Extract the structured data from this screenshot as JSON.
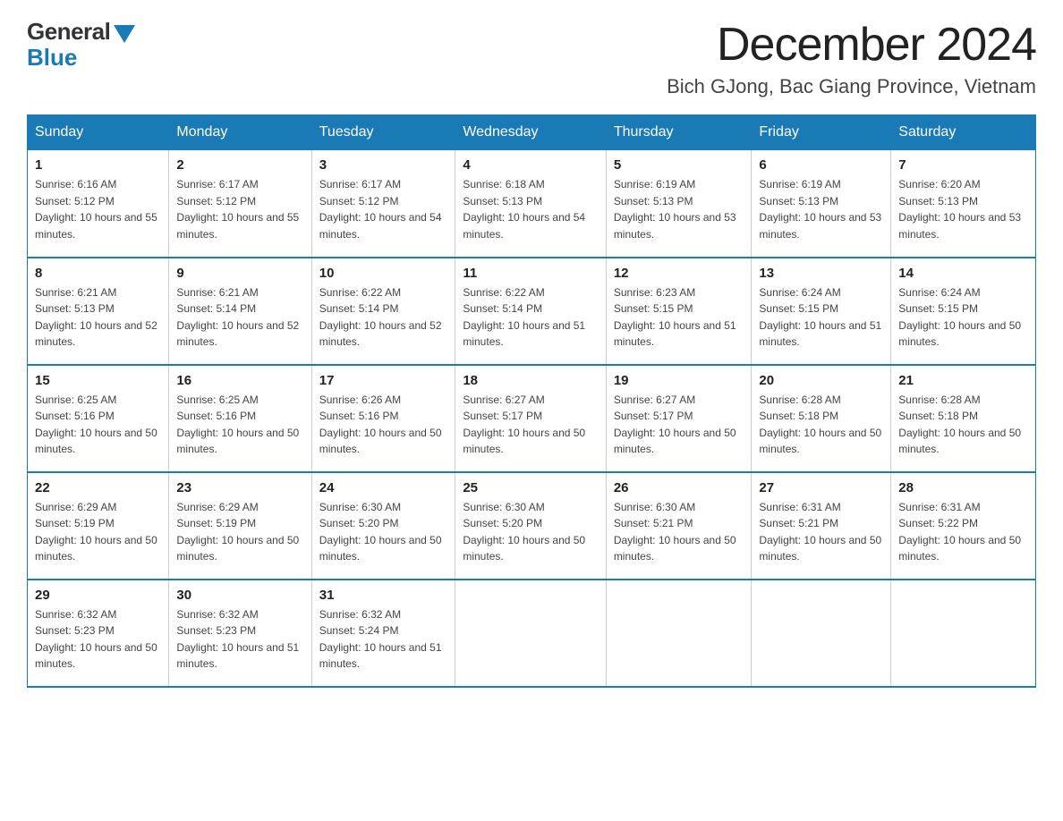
{
  "logo": {
    "general": "General",
    "blue": "Blue"
  },
  "header": {
    "month_year": "December 2024",
    "location": "Bich GJong, Bac Giang Province, Vietnam"
  },
  "weekdays": [
    "Sunday",
    "Monday",
    "Tuesday",
    "Wednesday",
    "Thursday",
    "Friday",
    "Saturday"
  ],
  "weeks": [
    [
      {
        "day": "1",
        "sunrise": "6:16 AM",
        "sunset": "5:12 PM",
        "daylight": "10 hours and 55 minutes."
      },
      {
        "day": "2",
        "sunrise": "6:17 AM",
        "sunset": "5:12 PM",
        "daylight": "10 hours and 55 minutes."
      },
      {
        "day": "3",
        "sunrise": "6:17 AM",
        "sunset": "5:12 PM",
        "daylight": "10 hours and 54 minutes."
      },
      {
        "day": "4",
        "sunrise": "6:18 AM",
        "sunset": "5:13 PM",
        "daylight": "10 hours and 54 minutes."
      },
      {
        "day": "5",
        "sunrise": "6:19 AM",
        "sunset": "5:13 PM",
        "daylight": "10 hours and 53 minutes."
      },
      {
        "day": "6",
        "sunrise": "6:19 AM",
        "sunset": "5:13 PM",
        "daylight": "10 hours and 53 minutes."
      },
      {
        "day": "7",
        "sunrise": "6:20 AM",
        "sunset": "5:13 PM",
        "daylight": "10 hours and 53 minutes."
      }
    ],
    [
      {
        "day": "8",
        "sunrise": "6:21 AM",
        "sunset": "5:13 PM",
        "daylight": "10 hours and 52 minutes."
      },
      {
        "day": "9",
        "sunrise": "6:21 AM",
        "sunset": "5:14 PM",
        "daylight": "10 hours and 52 minutes."
      },
      {
        "day": "10",
        "sunrise": "6:22 AM",
        "sunset": "5:14 PM",
        "daylight": "10 hours and 52 minutes."
      },
      {
        "day": "11",
        "sunrise": "6:22 AM",
        "sunset": "5:14 PM",
        "daylight": "10 hours and 51 minutes."
      },
      {
        "day": "12",
        "sunrise": "6:23 AM",
        "sunset": "5:15 PM",
        "daylight": "10 hours and 51 minutes."
      },
      {
        "day": "13",
        "sunrise": "6:24 AM",
        "sunset": "5:15 PM",
        "daylight": "10 hours and 51 minutes."
      },
      {
        "day": "14",
        "sunrise": "6:24 AM",
        "sunset": "5:15 PM",
        "daylight": "10 hours and 50 minutes."
      }
    ],
    [
      {
        "day": "15",
        "sunrise": "6:25 AM",
        "sunset": "5:16 PM",
        "daylight": "10 hours and 50 minutes."
      },
      {
        "day": "16",
        "sunrise": "6:25 AM",
        "sunset": "5:16 PM",
        "daylight": "10 hours and 50 minutes."
      },
      {
        "day": "17",
        "sunrise": "6:26 AM",
        "sunset": "5:16 PM",
        "daylight": "10 hours and 50 minutes."
      },
      {
        "day": "18",
        "sunrise": "6:27 AM",
        "sunset": "5:17 PM",
        "daylight": "10 hours and 50 minutes."
      },
      {
        "day": "19",
        "sunrise": "6:27 AM",
        "sunset": "5:17 PM",
        "daylight": "10 hours and 50 minutes."
      },
      {
        "day": "20",
        "sunrise": "6:28 AM",
        "sunset": "5:18 PM",
        "daylight": "10 hours and 50 minutes."
      },
      {
        "day": "21",
        "sunrise": "6:28 AM",
        "sunset": "5:18 PM",
        "daylight": "10 hours and 50 minutes."
      }
    ],
    [
      {
        "day": "22",
        "sunrise": "6:29 AM",
        "sunset": "5:19 PM",
        "daylight": "10 hours and 50 minutes."
      },
      {
        "day": "23",
        "sunrise": "6:29 AM",
        "sunset": "5:19 PM",
        "daylight": "10 hours and 50 minutes."
      },
      {
        "day": "24",
        "sunrise": "6:30 AM",
        "sunset": "5:20 PM",
        "daylight": "10 hours and 50 minutes."
      },
      {
        "day": "25",
        "sunrise": "6:30 AM",
        "sunset": "5:20 PM",
        "daylight": "10 hours and 50 minutes."
      },
      {
        "day": "26",
        "sunrise": "6:30 AM",
        "sunset": "5:21 PM",
        "daylight": "10 hours and 50 minutes."
      },
      {
        "day": "27",
        "sunrise": "6:31 AM",
        "sunset": "5:21 PM",
        "daylight": "10 hours and 50 minutes."
      },
      {
        "day": "28",
        "sunrise": "6:31 AM",
        "sunset": "5:22 PM",
        "daylight": "10 hours and 50 minutes."
      }
    ],
    [
      {
        "day": "29",
        "sunrise": "6:32 AM",
        "sunset": "5:23 PM",
        "daylight": "10 hours and 50 minutes."
      },
      {
        "day": "30",
        "sunrise": "6:32 AM",
        "sunset": "5:23 PM",
        "daylight": "10 hours and 51 minutes."
      },
      {
        "day": "31",
        "sunrise": "6:32 AM",
        "sunset": "5:24 PM",
        "daylight": "10 hours and 51 minutes."
      },
      null,
      null,
      null,
      null
    ]
  ]
}
